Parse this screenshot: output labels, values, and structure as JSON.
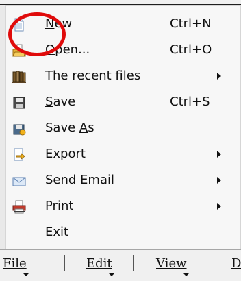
{
  "file_menu": {
    "items": [
      {
        "label_pre": "",
        "label_u": "N",
        "label_post": "ew",
        "shortcut": "Ctrl+N",
        "submenu": false,
        "icon": "new-document-icon"
      },
      {
        "label_pre": "",
        "label_u": "O",
        "label_post": "pen...",
        "shortcut": "Ctrl+O",
        "submenu": false,
        "icon": "open-folder-icon"
      },
      {
        "label_pre": "The recent files",
        "label_u": "",
        "label_post": "",
        "shortcut": "",
        "submenu": true,
        "icon": "recent-files-icon"
      },
      {
        "label_pre": "",
        "label_u": "S",
        "label_post": "ave",
        "shortcut": "Ctrl+S",
        "submenu": false,
        "icon": "save-icon"
      },
      {
        "label_pre": "Save ",
        "label_u": "A",
        "label_post": "s",
        "shortcut": "",
        "submenu": false,
        "icon": "save-as-icon"
      },
      {
        "label_pre": "Export",
        "label_u": "",
        "label_post": "",
        "shortcut": "",
        "submenu": true,
        "icon": "export-icon"
      },
      {
        "label_pre": "Send Email",
        "label_u": "",
        "label_post": "",
        "shortcut": "",
        "submenu": true,
        "icon": "email-icon"
      },
      {
        "label_pre": "Print",
        "label_u": "",
        "label_post": "",
        "shortcut": "",
        "submenu": true,
        "icon": "print-icon"
      },
      {
        "label_pre": "Exit",
        "label_u": "",
        "label_post": "",
        "shortcut": "",
        "submenu": false,
        "icon": ""
      }
    ]
  },
  "menubar": {
    "file": "File",
    "edit": "Edit",
    "view": "View",
    "next_partial": "D"
  },
  "colors": {
    "highlight_ring": "#e00b0b"
  }
}
